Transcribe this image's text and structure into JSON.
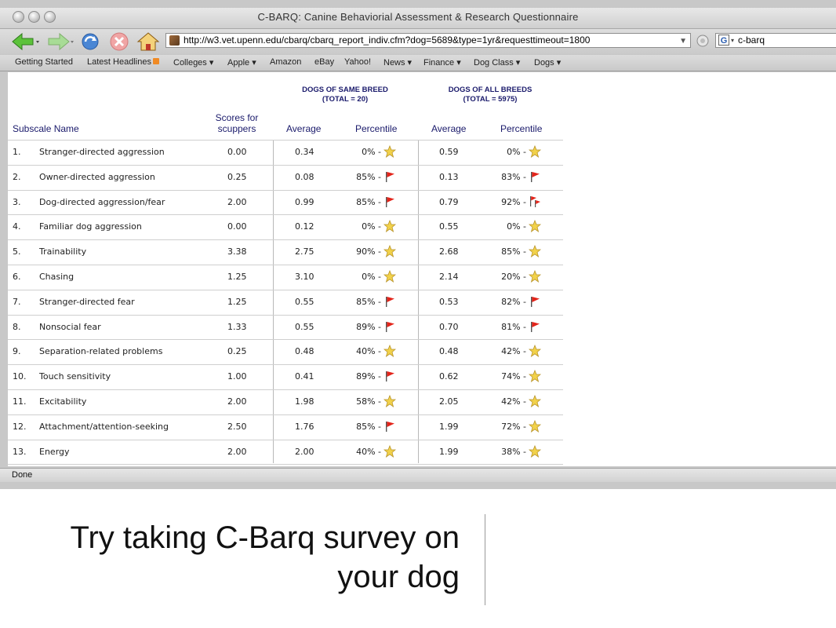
{
  "window": {
    "title": "C-BARQ: Canine Behaviorial Assessment & Research Questionnaire"
  },
  "toolbar": {
    "url": "http://w3.vet.upenn.edu/cbarq/cbarq_report_indiv.cfm?dog=5689&type=1yr&requesttimeout=1800",
    "search_value": "c-barq",
    "search_engine": "G"
  },
  "bookmarks": [
    "Getting Started",
    "Latest Headlines",
    "Colleges ▾",
    "Apple ▾",
    "Amazon",
    "eBay",
    "Yahoo!",
    "News ▾",
    "Finance ▾",
    "Dog Class ▾",
    "Dogs ▾"
  ],
  "report": {
    "group_same_breed": [
      "DOGS OF SAME BREED",
      "(TOTAL = 20)"
    ],
    "group_all_breeds": [
      "DOGS OF ALL BREEDS",
      "(TOTAL = 5975)"
    ],
    "col_subscale": "Subscale Name",
    "col_scores": [
      "Scores for",
      "scuppers"
    ],
    "col_average": "Average",
    "col_percentile": "Percentile",
    "rows": [
      {
        "num": "1.",
        "name": "Stranger-directed aggression",
        "score": "0.00",
        "same_avg": "0.34",
        "same_pct": "0% -",
        "same_icon": "star",
        "all_avg": "0.59",
        "all_pct": "0% -",
        "all_icon": "star"
      },
      {
        "num": "2.",
        "name": "Owner-directed aggression",
        "score": "0.25",
        "same_avg": "0.08",
        "same_pct": "85% -",
        "same_icon": "flag",
        "all_avg": "0.13",
        "all_pct": "83% -",
        "all_icon": "flag"
      },
      {
        "num": "3.",
        "name": "Dog-directed aggression/fear",
        "score": "2.00",
        "same_avg": "0.99",
        "same_pct": "85% -",
        "same_icon": "flag",
        "all_avg": "0.79",
        "all_pct": "92% -",
        "all_icon": "double-flag"
      },
      {
        "num": "4.",
        "name": "Familiar dog aggression",
        "score": "0.00",
        "same_avg": "0.12",
        "same_pct": "0% -",
        "same_icon": "star",
        "all_avg": "0.55",
        "all_pct": "0% -",
        "all_icon": "star"
      },
      {
        "num": "5.",
        "name": "Trainability",
        "score": "3.38",
        "same_avg": "2.75",
        "same_pct": "90% -",
        "same_icon": "star",
        "all_avg": "2.68",
        "all_pct": "85% -",
        "all_icon": "star"
      },
      {
        "num": "6.",
        "name": "Chasing",
        "score": "1.25",
        "same_avg": "3.10",
        "same_pct": "0% -",
        "same_icon": "star",
        "all_avg": "2.14",
        "all_pct": "20% -",
        "all_icon": "star"
      },
      {
        "num": "7.",
        "name": "Stranger-directed fear",
        "score": "1.25",
        "same_avg": "0.55",
        "same_pct": "85% -",
        "same_icon": "flag",
        "all_avg": "0.53",
        "all_pct": "82% -",
        "all_icon": "flag"
      },
      {
        "num": "8.",
        "name": "Nonsocial fear",
        "score": "1.33",
        "same_avg": "0.55",
        "same_pct": "89% -",
        "same_icon": "flag",
        "all_avg": "0.70",
        "all_pct": "81% -",
        "all_icon": "flag"
      },
      {
        "num": "9.",
        "name": "Separation-related problems",
        "score": "0.25",
        "same_avg": "0.48",
        "same_pct": "40% -",
        "same_icon": "star",
        "all_avg": "0.48",
        "all_pct": "42% -",
        "all_icon": "star"
      },
      {
        "num": "10.",
        "name": "Touch sensitivity",
        "score": "1.00",
        "same_avg": "0.41",
        "same_pct": "89% -",
        "same_icon": "flag",
        "all_avg": "0.62",
        "all_pct": "74% -",
        "all_icon": "star"
      },
      {
        "num": "11.",
        "name": "Excitability",
        "score": "2.00",
        "same_avg": "1.98",
        "same_pct": "58% -",
        "same_icon": "star",
        "all_avg": "2.05",
        "all_pct": "42% -",
        "all_icon": "star"
      },
      {
        "num": "12.",
        "name": "Attachment/attention-seeking",
        "score": "2.50",
        "same_avg": "1.76",
        "same_pct": "85% -",
        "same_icon": "flag",
        "all_avg": "1.99",
        "all_pct": "72% -",
        "all_icon": "star"
      },
      {
        "num": "13.",
        "name": "Energy",
        "score": "2.00",
        "same_avg": "2.00",
        "same_pct": "40% -",
        "same_icon": "star",
        "all_avg": "1.99",
        "all_pct": "38% -",
        "all_icon": "star"
      }
    ]
  },
  "status": {
    "text": "Done"
  },
  "caption": {
    "line1": "Try taking C-Barq survey  on",
    "line2": "your dog"
  },
  "colors": {
    "header_text": "#1a1a6b",
    "flag": "#e3251b",
    "star": "#f2d24a"
  }
}
